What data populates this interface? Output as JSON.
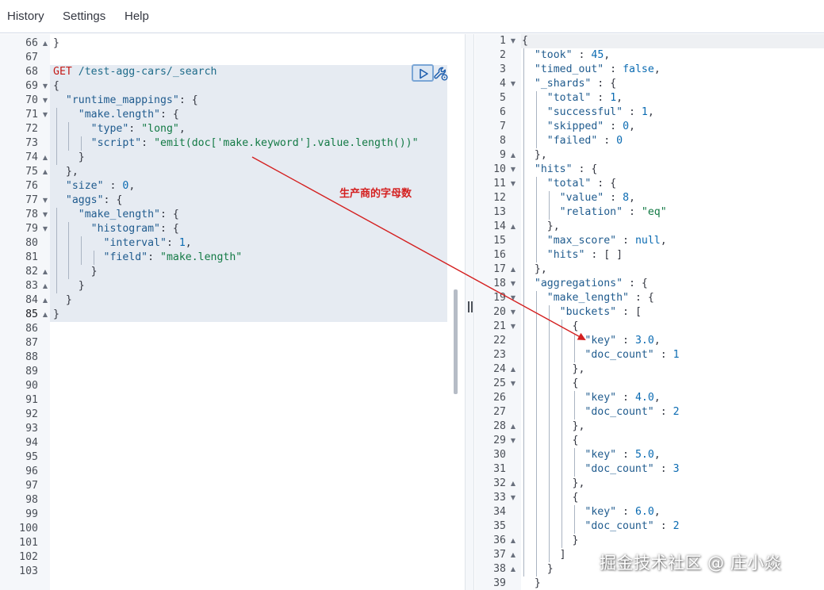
{
  "menu": {
    "history": "History",
    "settings": "Settings",
    "help": "Help"
  },
  "colors": {
    "accent": "#7aa6d6",
    "annotation": "#d42020",
    "request_bg": "#e6ebf2"
  },
  "icons": {
    "run": "play-icon",
    "settings": "wrench-icon"
  },
  "request": {
    "method": "GET",
    "url": "/test-agg-cars/_search",
    "line_numbers": [
      "66",
      "67",
      "68",
      "69",
      "70",
      "71",
      "72",
      "73",
      "74",
      "75",
      "76",
      "77",
      "78",
      "79",
      "80",
      "81",
      "82",
      "83",
      "84",
      "85",
      "86",
      "87",
      "88",
      "89",
      "90",
      "91",
      "92",
      "93",
      "94",
      "95",
      "96",
      "97",
      "98",
      "99",
      "100",
      "101",
      "102",
      "103"
    ],
    "lines": [
      "}",
      "",
      "GET /test-agg-cars/_search",
      "{",
      "  \"runtime_mappings\": {",
      "    \"make.length\": {",
      "      \"type\": \"long\",",
      "      \"script\": \"emit(doc['make.keyword'].value.length())\"",
      "    }",
      "  },",
      "  \"size\" : 0,",
      "  \"aggs\": {",
      "    \"make_length\": {",
      "      \"histogram\": {",
      "        \"interval\": 1,",
      "        \"field\": \"make.length\"",
      "      }",
      "    }",
      "  }",
      "}"
    ]
  },
  "response": {
    "line_numbers": [
      "1",
      "2",
      "3",
      "4",
      "5",
      "6",
      "7",
      "8",
      "9",
      "10",
      "11",
      "12",
      "13",
      "14",
      "15",
      "16",
      "17",
      "18",
      "19",
      "20",
      "21",
      "22",
      "23",
      "24",
      "25",
      "26",
      "27",
      "28",
      "29",
      "30",
      "31",
      "32",
      "33",
      "34",
      "35",
      "36",
      "37",
      "38",
      "39"
    ],
    "lines": [
      "{",
      "  \"took\" : 45,",
      "  \"timed_out\" : false,",
      "  \"_shards\" : {",
      "    \"total\" : 1,",
      "    \"successful\" : 1,",
      "    \"skipped\" : 0,",
      "    \"failed\" : 0",
      "  },",
      "  \"hits\" : {",
      "    \"total\" : {",
      "      \"value\" : 8,",
      "      \"relation\" : \"eq\"",
      "    },",
      "    \"max_score\" : null,",
      "    \"hits\" : [ ]",
      "  },",
      "  \"aggregations\" : {",
      "    \"make_length\" : {",
      "      \"buckets\" : [",
      "        {",
      "          \"key\" : 3.0,",
      "          \"doc_count\" : 1",
      "        },",
      "        {",
      "          \"key\" : 4.0,",
      "          \"doc_count\" : 2",
      "        },",
      "        {",
      "          \"key\" : 5.0,",
      "          \"doc_count\" : 3",
      "        },",
      "        {",
      "          \"key\" : 6.0,",
      "          \"doc_count\" : 2",
      "        }",
      "      ]",
      "    }",
      "  }"
    ]
  },
  "annotation": {
    "text": "生产商的字母数"
  },
  "watermark": {
    "text": "掘金技术社区 @ 庄小焱"
  }
}
